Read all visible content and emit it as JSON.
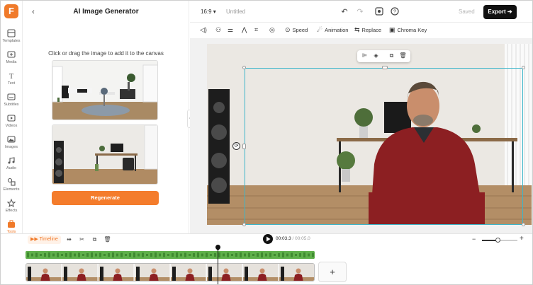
{
  "app": {
    "logo_letter": "F"
  },
  "rail": [
    {
      "id": "templates",
      "label": "Templates",
      "icon": "templates-icon"
    },
    {
      "id": "media",
      "label": "Media",
      "icon": "media-icon"
    },
    {
      "id": "text",
      "label": "Text",
      "icon": "text-icon"
    },
    {
      "id": "subtitles",
      "label": "Subtitles",
      "icon": "subtitles-icon"
    },
    {
      "id": "videos",
      "label": "Videos",
      "icon": "videos-icon"
    },
    {
      "id": "images",
      "label": "Images",
      "icon": "images-icon"
    },
    {
      "id": "audio",
      "label": "Audio",
      "icon": "audio-icon"
    },
    {
      "id": "elements",
      "label": "Elements",
      "icon": "elements-icon"
    },
    {
      "id": "effects",
      "label": "Effects",
      "icon": "effects-icon"
    },
    {
      "id": "tools",
      "label": "Tools",
      "icon": "tools-icon",
      "active": true
    }
  ],
  "panel": {
    "title": "AI Image Generator",
    "hint": "Click or drag the image to add it to the canvas",
    "regenerate_label": "Regenerate"
  },
  "topbar": {
    "ratio": "16:9",
    "title": "Untitled",
    "saved_label": "Saved",
    "export_label": "Export"
  },
  "toolbar": {
    "speed": "Speed",
    "animation": "Animation",
    "replace": "Replace",
    "chroma_key": "Chroma Key"
  },
  "timeline": {
    "label": "Timeline",
    "current_time": "00:03.3",
    "total_time": "/ 00:05.0",
    "zoom_level": 0.45
  },
  "colors": {
    "accent": "#f47c2c",
    "selection": "#3db5c9",
    "audio_track": "#5fb04a"
  }
}
